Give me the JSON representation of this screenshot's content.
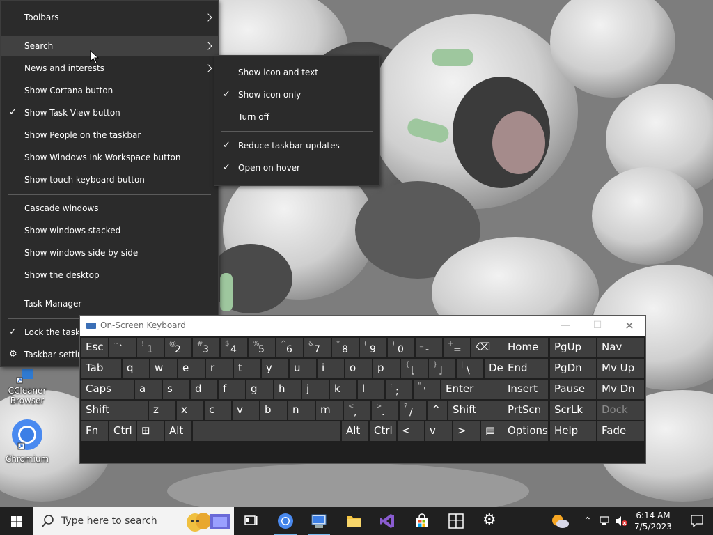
{
  "taskbar_menu": {
    "items": [
      {
        "label": "Toolbars",
        "has_submenu": true,
        "checked": false
      },
      {
        "label": "Search",
        "has_submenu": true,
        "checked": false,
        "highlighted": true
      },
      {
        "label": "News and interests",
        "has_submenu": true,
        "checked": false
      },
      {
        "label": "Show Cortana button",
        "checked": false
      },
      {
        "label": "Show Task View button",
        "checked": true
      },
      {
        "label": "Show People on the taskbar",
        "checked": false
      },
      {
        "label": "Show Windows Ink Workspace button",
        "checked": false
      },
      {
        "label": "Show touch keyboard button",
        "checked": false
      },
      {
        "label": "Cascade windows",
        "checked": false
      },
      {
        "label": "Show windows stacked",
        "checked": false
      },
      {
        "label": "Show windows side by side",
        "checked": false
      },
      {
        "label": "Show the desktop",
        "checked": false
      },
      {
        "label": "Task Manager",
        "checked": false
      },
      {
        "label": "Lock the taskbar",
        "checked": true
      },
      {
        "label": "Taskbar settings",
        "icon": "gear-icon"
      }
    ]
  },
  "search_submenu": {
    "items": [
      {
        "label": "Show icon and text",
        "checked": false
      },
      {
        "label": "Show icon only",
        "checked": true
      },
      {
        "label": "Turn off",
        "checked": false
      },
      {
        "label": "Reduce taskbar updates",
        "checked": true
      },
      {
        "label": "Open on hover",
        "checked": true
      }
    ]
  },
  "osk": {
    "title": "On-Screen Keyboard",
    "rows": [
      [
        {
          "label": "Esc"
        },
        {
          "sym": "~",
          "main": "`"
        },
        {
          "sym": "!",
          "main": "1"
        },
        {
          "sym": "@",
          "main": "2"
        },
        {
          "sym": "#",
          "main": "3"
        },
        {
          "sym": "$",
          "main": "4"
        },
        {
          "sym": "%",
          "main": "5"
        },
        {
          "sym": "^",
          "main": "6"
        },
        {
          "sym": "&",
          "main": "7"
        },
        {
          "sym": "*",
          "main": "8"
        },
        {
          "sym": "(",
          "main": "9"
        },
        {
          "sym": ")",
          "main": "0"
        },
        {
          "sym": "_",
          "main": "-"
        },
        {
          "sym": "+",
          "main": "="
        },
        {
          "label": "⌫"
        }
      ],
      [
        {
          "label": "Tab"
        },
        {
          "label": "q"
        },
        {
          "label": "w"
        },
        {
          "label": "e"
        },
        {
          "label": "r"
        },
        {
          "label": "t"
        },
        {
          "label": "y"
        },
        {
          "label": "u"
        },
        {
          "label": "i"
        },
        {
          "label": "o"
        },
        {
          "label": "p"
        },
        {
          "sym": "{",
          "main": "["
        },
        {
          "sym": "}",
          "main": "]"
        },
        {
          "sym": "|",
          "main": "\\"
        },
        {
          "label": "Del"
        }
      ],
      [
        {
          "label": "Caps"
        },
        {
          "label": "a"
        },
        {
          "label": "s"
        },
        {
          "label": "d"
        },
        {
          "label": "f"
        },
        {
          "label": "g"
        },
        {
          "label": "h"
        },
        {
          "label": "j"
        },
        {
          "label": "k"
        },
        {
          "label": "l"
        },
        {
          "sym": ":",
          "main": ";"
        },
        {
          "sym": "\"",
          "main": "'"
        },
        {
          "label": "Enter"
        }
      ],
      [
        {
          "label": "Shift"
        },
        {
          "label": "z"
        },
        {
          "label": "x"
        },
        {
          "label": "c"
        },
        {
          "label": "v"
        },
        {
          "label": "b"
        },
        {
          "label": "n"
        },
        {
          "label": "m"
        },
        {
          "sym": "<",
          "main": ","
        },
        {
          "sym": ">",
          "main": "."
        },
        {
          "sym": "?",
          "main": "/"
        },
        {
          "label": "^"
        },
        {
          "label": "Shift"
        }
      ],
      [
        {
          "label": "Fn"
        },
        {
          "label": "Ctrl"
        },
        {
          "label": "⊞"
        },
        {
          "label": "Alt"
        },
        {
          "label": ""
        },
        {
          "label": "Alt"
        },
        {
          "label": "Ctrl"
        },
        {
          "label": "<"
        },
        {
          "label": "v"
        },
        {
          "label": ">"
        },
        {
          "label": "▤"
        }
      ]
    ],
    "nav_keys": [
      [
        "Home",
        "PgUp",
        "Nav"
      ],
      [
        "End",
        "PgDn",
        "Mv Up"
      ],
      [
        "Insert",
        "Pause",
        "Mv Dn"
      ],
      [
        "PrtScn",
        "ScrLk",
        "Dock"
      ],
      [
        "Options",
        "Help",
        "Fade"
      ]
    ]
  },
  "desktop_icons": [
    {
      "label": "CCleaner Browser",
      "line1": "CCleaner",
      "line2": "Browser"
    },
    {
      "label": "Chromium"
    }
  ],
  "taskbar": {
    "search_placeholder": "Type here to search",
    "apps": [
      "task-view-icon",
      "chromium-icon",
      "network-app-icon",
      "file-explorer-icon",
      "visual-studio-icon",
      "microsoft-store-icon",
      "windows-app-icon",
      "settings-icon"
    ],
    "time": "6:14 AM",
    "date": "7/5/2023"
  },
  "colors": {
    "menu_bg": "#2b2b2b",
    "menu_hover": "#414141",
    "osk_bg": "#1f1f1f",
    "key_bg": "#3f3f3f",
    "taskbar_bg": "#202020",
    "accent": "#76b9ed"
  }
}
